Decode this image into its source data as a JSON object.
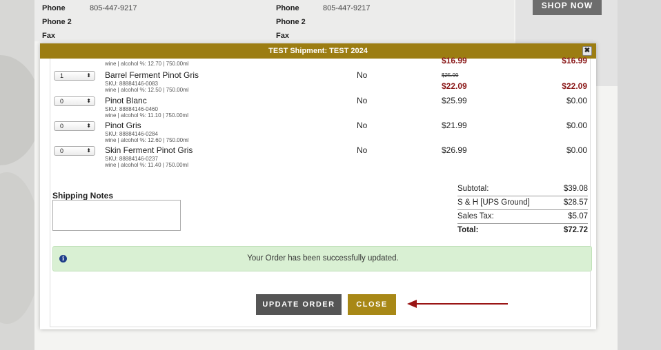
{
  "background": {
    "rows": [
      {
        "label": "Phone",
        "value": "805-447-9217",
        "label2": "Phone",
        "value2": "805-447-9217"
      },
      {
        "label": "Phone 2",
        "label2": "Phone 2"
      },
      {
        "label": "Fax",
        "label2": "Fax"
      }
    ],
    "shop_button": "SHOP NOW"
  },
  "modal": {
    "title": "TEST Shipment: TEST 2024",
    "close_icon": "✖",
    "top_partial": {
      "info": "wine | alcohol %: 12.70 | 750.00ml",
      "price": "$16.99",
      "total": "$16.99"
    },
    "items": [
      {
        "qty": "1",
        "name": "Barrel Ferment Pinot Gris",
        "sku": "SKU: 88884146-0083",
        "info": "wine | alcohol %: 12.50 | 750.00ml",
        "taxable": "No",
        "orig_price": "$25.99",
        "price": "$22.09",
        "total": "$22.09"
      },
      {
        "qty": "0",
        "name": "Pinot Blanc",
        "sku": "SKU: 88884146-0460",
        "info": "wine | alcohol %: 11.10 | 750.00ml",
        "taxable": "No",
        "price": "$25.99",
        "total": "$0.00"
      },
      {
        "qty": "0",
        "name": "Pinot Gris",
        "sku": "SKU: 88884146-0284",
        "info": "wine | alcohol %: 12.60 | 750.00ml",
        "taxable": "No",
        "price": "$21.99",
        "total": "$0.00"
      },
      {
        "qty": "0",
        "name": "Skin Ferment Pinot Gris",
        "sku": "SKU: 88884146-0237",
        "info": "wine | alcohol %: 11.40 | 750.00ml",
        "taxable": "No",
        "price": "$26.99",
        "total": "$0.00"
      }
    ],
    "shipping_notes_label": "Shipping Notes",
    "shipping_notes_value": "",
    "summary": [
      {
        "label": "Subtotal:",
        "value": "$39.08"
      },
      {
        "label": "S & H [UPS Ground]",
        "value": "$28.57"
      },
      {
        "label": "Sales Tax:",
        "value": "$5.07"
      },
      {
        "label": "Total:",
        "value": "$72.72"
      }
    ],
    "alert": {
      "icon": "i",
      "message": "Your Order has been successfully updated."
    },
    "update_button": "UPDATE ORDER",
    "close_button": "CLOSE"
  },
  "colors": {
    "header": "#9c7d12",
    "close_btn": "#a88816",
    "update_btn": "#555555",
    "price_red": "#8b1a1a",
    "arrow": "#9a1515",
    "alert_bg": "#d9f0d3"
  }
}
